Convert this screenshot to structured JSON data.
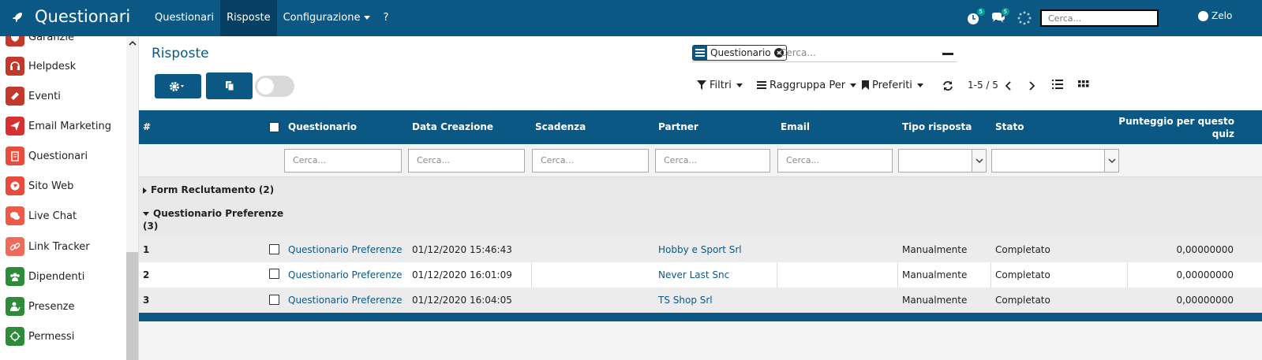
{
  "app": {
    "title": "Questionari",
    "logo_icon": "rocket-icon",
    "brand_color": "#0c5884"
  },
  "topnav": {
    "items": [
      {
        "label": "Questionari",
        "active": false
      },
      {
        "label": "Risposte",
        "active": true
      },
      {
        "label": "Configurazione",
        "active": false,
        "dropdown": true
      },
      {
        "label": "?",
        "active": false
      }
    ]
  },
  "systray": {
    "activity_badge": "5",
    "messages_badge": "5",
    "search_placeholder": "Cerca...",
    "user_name": "Zelo"
  },
  "sidebar": {
    "items": [
      {
        "label": "Garanzie",
        "icon": "shield-check-icon",
        "color": "#c0392b"
      },
      {
        "label": "Helpdesk",
        "icon": "headset-icon",
        "color": "#c0392b"
      },
      {
        "label": "Eventi",
        "icon": "ticket-icon",
        "color": "#c0392b"
      },
      {
        "label": "Email Marketing",
        "icon": "paper-plane-icon",
        "color": "#d63031"
      },
      {
        "label": "Questionari",
        "icon": "clipboard-icon",
        "color": "#e74c3c"
      },
      {
        "label": "Sito Web",
        "icon": "globe-icon",
        "color": "#e74c3c"
      },
      {
        "label": "Live Chat",
        "icon": "chat-bubbles-icon",
        "color": "#ee5a4a"
      },
      {
        "label": "Link Tracker",
        "icon": "link-icon",
        "color": "#ee6a5a"
      },
      {
        "label": "Dipendenti",
        "icon": "users-icon",
        "color": "#2e8b3a"
      },
      {
        "label": "Presenze",
        "icon": "user-check-icon",
        "color": "#2e8b3a"
      },
      {
        "label": "Permessi",
        "icon": "sun-icon",
        "color": "#2e8b3a"
      }
    ]
  },
  "control_panel": {
    "breadcrumb": "Risposte",
    "facet_label": "Questionario",
    "search_placeholder": "Cerca...",
    "filters_label": "Filtri",
    "groupby_label": "Raggruppa Per",
    "favorites_label": "Preferiti",
    "pager": "1-5 / 5"
  },
  "table": {
    "headers": {
      "index": "#",
      "questionario": "Questionario",
      "data_creazione": "Data Creazione",
      "scadenza": "Scadenza",
      "partner": "Partner",
      "email": "Email",
      "tipo_risposta": "Tipo risposta",
      "stato": "Stato",
      "punteggio_line1": "Punteggio per questo",
      "punteggio_line2": "quiz"
    },
    "filter_placeholder": "Cerca...",
    "groups": [
      {
        "label": "Form Reclutamento (2)",
        "expanded": false
      },
      {
        "label_line1": "Questionario Preferenze",
        "label_line2": "(3)",
        "expanded": true
      }
    ],
    "rows": [
      {
        "index": "1",
        "questionario": "Questionario Preferenze",
        "data_creazione": "01/12/2020 15:46:43",
        "scadenza": "",
        "partner": "Hobby e Sport Srl",
        "email": "",
        "tipo_risposta": "Manualmente",
        "stato": "Completato",
        "punteggio": "0,00000000"
      },
      {
        "index": "2",
        "questionario": "Questionario Preferenze",
        "data_creazione": "01/12/2020 16:01:09",
        "scadenza": "",
        "partner": "Never Last Snc",
        "email": "",
        "tipo_risposta": "Manualmente",
        "stato": "Completato",
        "punteggio": "0,00000000"
      },
      {
        "index": "3",
        "questionario": "Questionario Preferenze",
        "data_creazione": "01/12/2020 16:04:05",
        "scadenza": "",
        "partner": "TS Shop Srl",
        "email": "",
        "tipo_risposta": "Manualmente",
        "stato": "Completato",
        "punteggio": "0,00000000"
      }
    ]
  }
}
